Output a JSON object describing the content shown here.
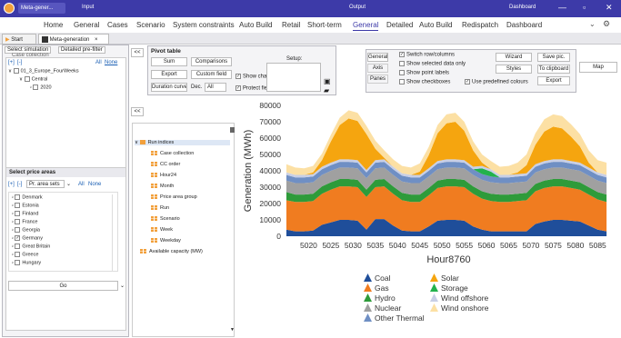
{
  "titlebar": {
    "app_title": "Meta-gener...",
    "input": "Input",
    "output": "Output",
    "dashboard": "Dashboard",
    "min": "—",
    "max": "▫",
    "close": "✕"
  },
  "ribbon_tabs": [
    "Home",
    "General",
    "Cases",
    "Scenario",
    "System constraints",
    "Auto Build",
    "Retail",
    "Short-term",
    "General",
    "Detailed",
    "Auto Build",
    "Redispatch",
    "Dashboard"
  ],
  "active_ribbon_tab": "General",
  "doc_tabs": [
    {
      "label": "Start"
    },
    {
      "label": "Meta-generation"
    }
  ],
  "close_glyph": "×",
  "left_panel": {
    "subtabs": [
      "Select simulation",
      "Detailed pre-filter"
    ],
    "header": "Case collection",
    "expand": "[+]",
    "collapse": "[-]",
    "all": "All",
    "none": "None",
    "tree": [
      "01_3_Europe_FourWeeks",
      "Central",
      "2020"
    ],
    "price_areas_title": "Select price areas",
    "price_sets_placeholder": "Pr. area sets",
    "areas": [
      "Denmark",
      "Estonia",
      "Finland",
      "France",
      "Georgia",
      "Germany",
      "Great Britain",
      "Greece",
      "Hungary"
    ],
    "checked": [
      "Germany"
    ],
    "go": "Go"
  },
  "pivot": {
    "title": "Pivot table",
    "sum": "Sum",
    "comparisons": "Comparisons",
    "export": "Export",
    "custom_field": "Custom field",
    "duration_curve": "Duration curve",
    "dec": "Dec.",
    "dec_value": "All",
    "show_chart": "Show chart",
    "protect_fields": "Protect fields",
    "setup": "Setup:"
  },
  "options": {
    "side_tabs": [
      "General",
      "Axis",
      "Panes"
    ],
    "checks": [
      "Switch row/columns",
      "Show selected data only",
      "Show point labels",
      "Show checkboxes"
    ],
    "predef": "Use predefined colours",
    "wizard": "Wizard",
    "save_pic": "Save pic.",
    "styles": "Styles",
    "to_clipboard": "To clipboard",
    "export": "Export",
    "map": "Map"
  },
  "collapse_btn": "<<",
  "field_tree": {
    "root": "Run indices",
    "items": [
      "Case collection",
      "CC order",
      "Hour24",
      "Month",
      "Price area group",
      "Run",
      "Scenario",
      "Week",
      "Weekday"
    ],
    "extra": "Available capacity (MW)"
  },
  "chart_data": {
    "type": "area",
    "stacked": true,
    "xlabel": "Hour8760",
    "ylabel": "Generation (MWh)",
    "ylim": [
      0,
      80000
    ],
    "yticks": [
      0,
      10000,
      20000,
      30000,
      40000,
      50000,
      60000,
      70000,
      80000
    ],
    "xlim": [
      5015,
      5088
    ],
    "xticks": [
      5020,
      5025,
      5030,
      5035,
      5040,
      5045,
      5050,
      5055,
      5060,
      5065,
      5070,
      5075,
      5080,
      5085
    ],
    "x": [
      5015,
      5017,
      5019,
      5021,
      5023,
      5025,
      5027,
      5029,
      5031,
      5033,
      5035,
      5037,
      5039,
      5041,
      5043,
      5045,
      5047,
      5049,
      5051,
      5053,
      5055,
      5057,
      5059,
      5061,
      5063,
      5065,
      5067,
      5069,
      5071,
      5073,
      5075,
      5077,
      5079,
      5081,
      5083,
      5085,
      5087
    ],
    "series": [
      {
        "name": "Coal",
        "color": "#1f4e9a",
        "values": [
          4000,
          3000,
          3000,
          3500,
          7000,
          8500,
          10000,
          10000,
          9500,
          4000,
          10500,
          10500,
          6500,
          3500,
          3000,
          3000,
          6000,
          9500,
          10000,
          10000,
          9500,
          6000,
          4000,
          3000,
          3000,
          3000,
          3000,
          3000,
          7500,
          9000,
          10000,
          10000,
          9500,
          9000,
          6500,
          4000,
          3000
        ]
      },
      {
        "name": "Gas",
        "color": "#f07c20",
        "values": [
          18000,
          18000,
          18000,
          18000,
          19000,
          20000,
          20500,
          20500,
          20500,
          20000,
          19500,
          20000,
          19500,
          18500,
          18000,
          18000,
          19000,
          20000,
          20500,
          20500,
          20500,
          20000,
          19000,
          18500,
          18000,
          18000,
          18500,
          19000,
          20000,
          20500,
          20500,
          20500,
          20000,
          19500,
          19000,
          18500,
          18000
        ]
      },
      {
        "name": "Hydro",
        "color": "#2e9b3a",
        "values": [
          5000,
          4500,
          4500,
          4500,
          4500,
          4500,
          4500,
          4500,
          4500,
          4500,
          4500,
          4500,
          4500,
          4500,
          4500,
          4500,
          4500,
          4500,
          4500,
          4500,
          4500,
          4500,
          4500,
          4500,
          4500,
          4500,
          4500,
          4500,
          4500,
          4500,
          4500,
          4500,
          4500,
          4500,
          4500,
          4500,
          4500
        ]
      },
      {
        "name": "Nuclear",
        "color": "#a0a0a0",
        "values": [
          7000,
          7000,
          7000,
          7000,
          7000,
          7000,
          7000,
          7000,
          7000,
          7000,
          7000,
          7000,
          7000,
          7000,
          7000,
          7000,
          7000,
          7000,
          7000,
          7000,
          7000,
          7000,
          7000,
          7000,
          7000,
          7000,
          7000,
          7000,
          7000,
          7000,
          7000,
          7000,
          7000,
          7000,
          7000,
          7000,
          7000
        ]
      },
      {
        "name": "Other Thermal",
        "color": "#6f8fc4",
        "values": [
          3500,
          3500,
          3500,
          3500,
          3500,
          3500,
          3500,
          3500,
          3500,
          3500,
          3500,
          3500,
          3500,
          3500,
          3500,
          3500,
          3500,
          3500,
          3500,
          3500,
          3500,
          3500,
          3500,
          3500,
          3500,
          3500,
          3500,
          3500,
          3500,
          3500,
          3500,
          3500,
          3500,
          3500,
          3500,
          3500,
          3500
        ]
      },
      {
        "name": "Solar",
        "color": "#f5a50f",
        "values": [
          0,
          0,
          0,
          1000,
          4000,
          13000,
          21000,
          25000,
          24000,
          22000,
          7000,
          1000,
          0,
          0,
          0,
          2000,
          8000,
          17000,
          22000,
          23000,
          18000,
          10000,
          2000,
          0,
          0,
          0,
          1000,
          5000,
          12000,
          18000,
          20000,
          19000,
          15000,
          10000,
          3000,
          0,
          0
        ]
      },
      {
        "name": "Storage",
        "color": "#22b24c",
        "values": [
          0,
          0,
          0,
          0,
          0,
          0,
          0,
          0,
          0,
          0,
          0,
          0,
          0,
          0,
          0,
          0,
          0,
          0,
          0,
          0,
          0,
          0,
          3500,
          3000,
          0,
          0,
          0,
          0,
          0,
          0,
          0,
          0,
          0,
          0,
          0,
          0,
          0
        ]
      },
      {
        "name": "Wind offshore",
        "color": "#c8cfe6",
        "values": [
          1500,
          1500,
          1500,
          1500,
          1500,
          1500,
          1500,
          1500,
          1500,
          1500,
          1500,
          1500,
          1500,
          1500,
          1500,
          1500,
          1500,
          1500,
          1500,
          1500,
          1500,
          1500,
          1500,
          1500,
          1500,
          1500,
          1500,
          1500,
          1500,
          1500,
          1500,
          1500,
          1500,
          1500,
          1500,
          1500,
          1500
        ]
      },
      {
        "name": "Wind onshore",
        "color": "#fce0a4",
        "values": [
          5000,
          4500,
          4000,
          4000,
          4000,
          4000,
          4500,
          5000,
          5000,
          5000,
          5000,
          4500,
          4500,
          4500,
          4500,
          5000,
          5000,
          5000,
          5500,
          5500,
          5500,
          5500,
          5000,
          5000,
          5000,
          5500,
          6000,
          6500,
          7000,
          7500,
          7500,
          7500,
          7500,
          7500,
          7500,
          7500,
          7500
        ]
      }
    ],
    "draw_order": [
      "Coal",
      "Gas",
      "Hydro",
      "Nuclear",
      "Other Thermal",
      "Storage",
      "Wind offshore",
      "Solar",
      "Wind onshore"
    ],
    "legend_position": "bottom",
    "grid": false
  }
}
